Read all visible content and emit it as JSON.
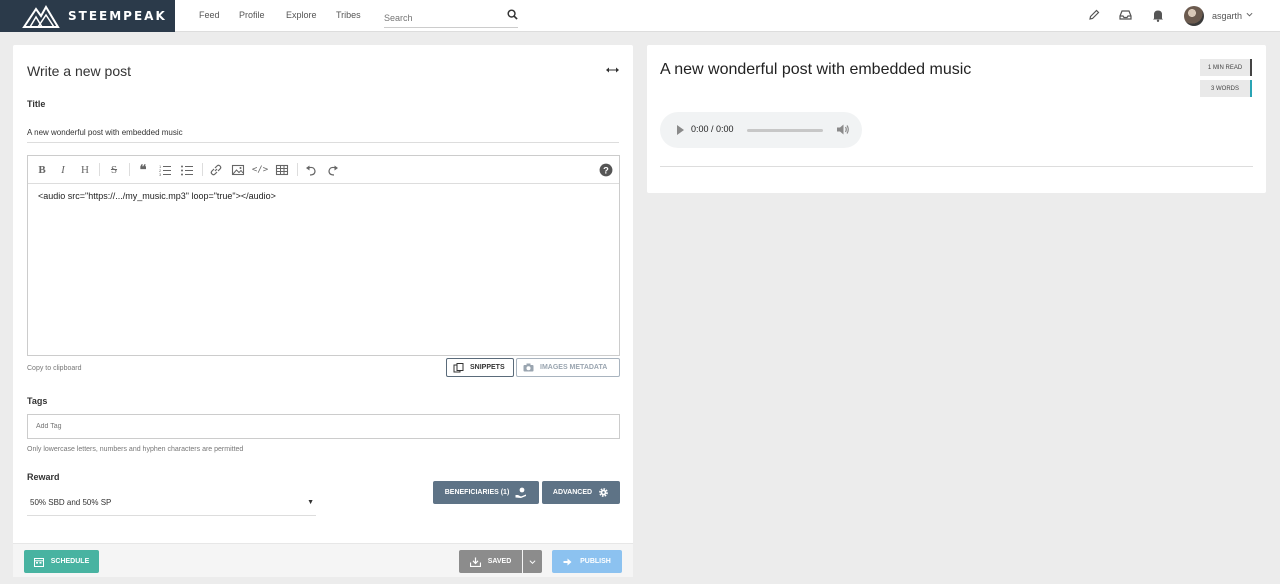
{
  "brand": {
    "name": "STEEMPEAK"
  },
  "nav": {
    "links": [
      "Feed",
      "Profile",
      "Explore",
      "Tribes"
    ],
    "search_placeholder": "Search",
    "username": "asgarth"
  },
  "editor": {
    "heading": "Write a new post",
    "title_label": "Title",
    "title_value": "A new wonderful post with embedded music",
    "body": "<audio src=\"https://.../my_music.mp3\" loop=\"true\"></audio>",
    "copy_clipboard": "Copy to clipboard",
    "snippets_label": "SNIPPETS",
    "images_metadata_label": "IMAGES METADATA",
    "tags_label": "Tags",
    "tags_placeholder": "Add Tag",
    "tags_help": "Only lowercase letters, numbers and hyphen characters are permitted",
    "reward_label": "Reward",
    "reward_value": "50% SBD and 50% SP",
    "beneficiaries_label": "BENEFICIARIES (1)",
    "advanced_label": "ADVANCED"
  },
  "footer": {
    "schedule_label": "SCHEDULE",
    "saved_label": "SAVED",
    "publish_label": "PUBLISH"
  },
  "preview": {
    "title": "A new wonderful post with embedded music",
    "read_time": "1 MIN READ",
    "word_count": "3 WORDS",
    "audio_time": "0:00 / 0:00"
  },
  "colors": {
    "logo_bg": "#2b3a4a",
    "dark_button": "#5e7386",
    "schedule": "#48b3a1",
    "saved": "#8c8c8c",
    "publish": "#8cc2f0",
    "words_accent": "#2aa4b4"
  },
  "icons": {
    "toolbar": [
      "bold-icon",
      "italic-icon",
      "heading-icon",
      "strikethrough-icon",
      "quote-icon",
      "ordered-list-icon",
      "unordered-list-icon",
      "link-icon",
      "image-icon",
      "code-icon",
      "table-icon",
      "undo-icon",
      "redo-icon",
      "help-icon"
    ],
    "nav": [
      "search-icon",
      "pencil-icon",
      "inbox-icon",
      "bell-icon",
      "chevron-down-icon"
    ]
  }
}
